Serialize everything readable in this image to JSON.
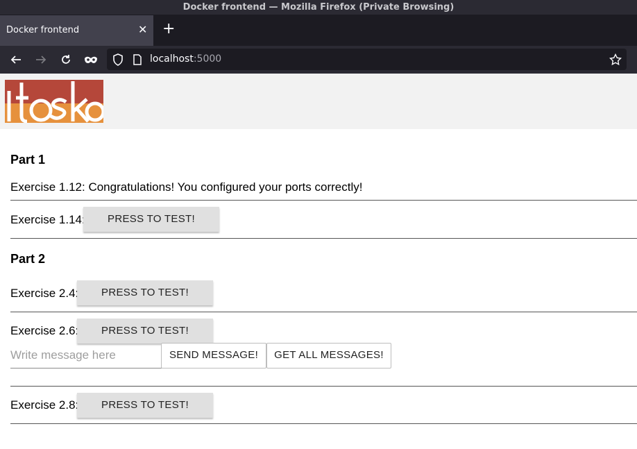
{
  "window": {
    "title": "Docker frontend — Mozilla Firefox (Private Browsing)"
  },
  "tab": {
    "title": "Docker frontend",
    "close_icon": "close-icon"
  },
  "address": {
    "host": "localhost",
    "port": ":5000"
  },
  "logo": {
    "text": "itoska",
    "colors": {
      "top": "#b5473a",
      "bottom": "#e6913d"
    }
  },
  "part1": {
    "heading": "Part 1",
    "ex112": "Exercise 1.12: Congratulations! You configured your ports correctly!",
    "ex114_label": "Exercise 1.14:",
    "ex114_button": "PRESS TO TEST!"
  },
  "part2": {
    "heading": "Part 2",
    "ex24_label": "Exercise 2.4:",
    "ex24_button": "PRESS TO TEST!",
    "ex26_label": "Exercise 2.6:",
    "ex26_button": "PRESS TO TEST!",
    "message_placeholder": "Write message here",
    "send_button": "SEND MESSAGE!",
    "get_button": "GET ALL MESSAGES!",
    "ex28_label": "Exercise 2.8:",
    "ex28_button": "PRESS TO TEST!"
  }
}
